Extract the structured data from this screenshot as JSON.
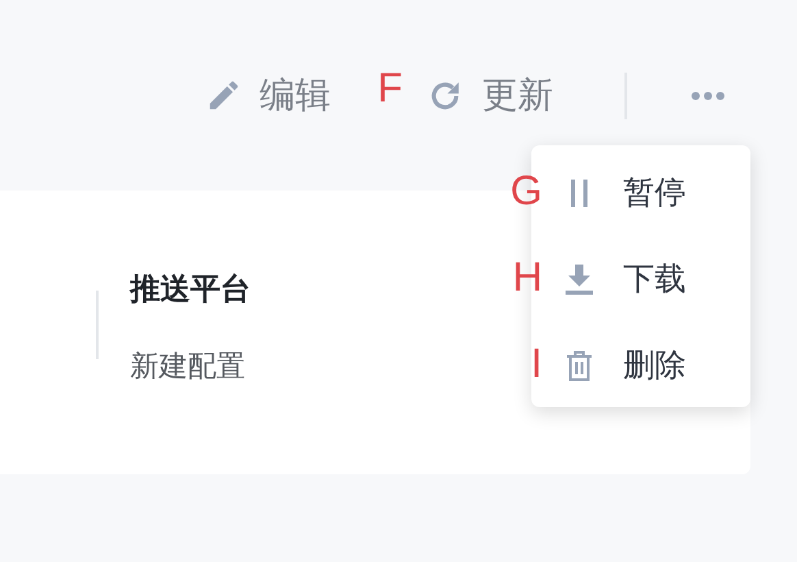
{
  "toolbar": {
    "items": [
      {
        "kind": "action",
        "label": "编辑"
      },
      {
        "kind": "marker",
        "label": "F"
      },
      {
        "kind": "action",
        "label": "更新"
      },
      {
        "kind": "more"
      }
    ]
  },
  "card": {
    "title": "推送平台",
    "subtitle": "新建配置"
  },
  "menu": {
    "items": [
      {
        "label": "暂停",
        "marker": "G"
      },
      {
        "label": "下载",
        "marker": "H"
      },
      {
        "label": "删除",
        "marker": "I"
      }
    ]
  }
}
